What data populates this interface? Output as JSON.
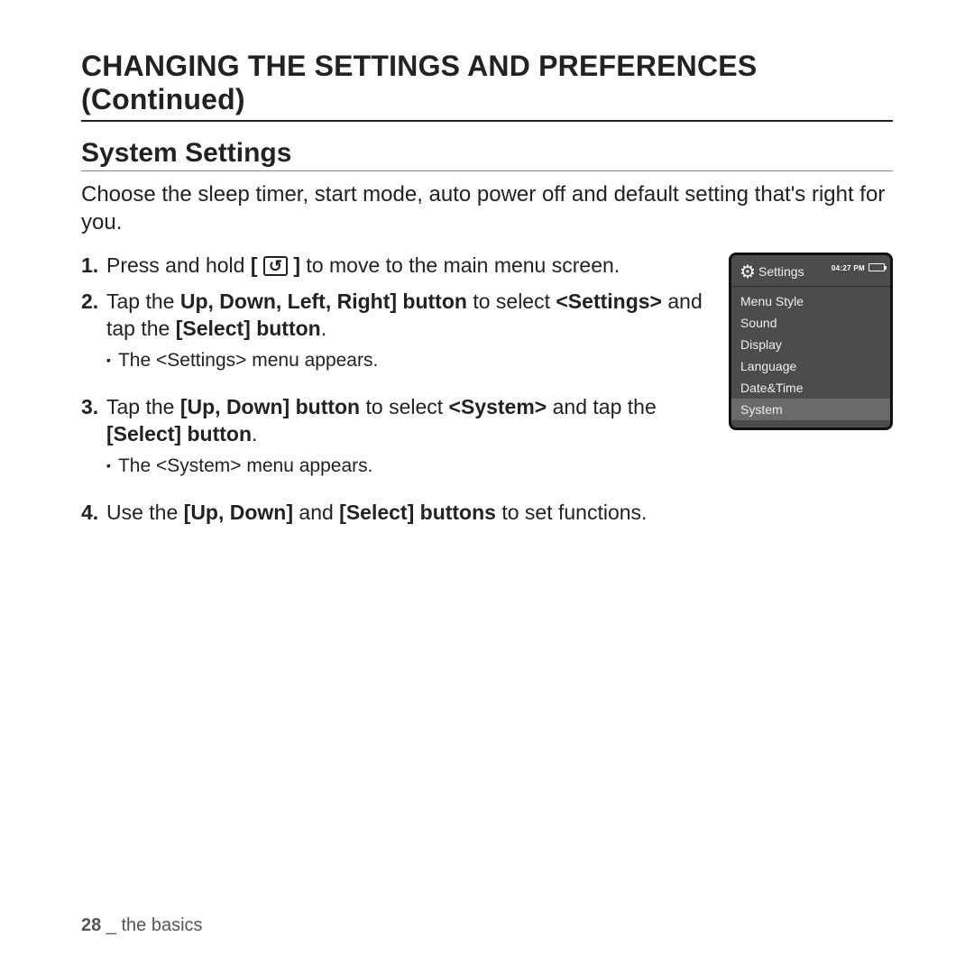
{
  "title": "CHANGING THE SETTINGS AND PREFERENCES (Continued)",
  "section": "System Settings",
  "intro": "Choose the sleep timer, start mode, auto power off and default setting that's right for you.",
  "steps": {
    "s1": {
      "num": "1.",
      "pre": "Press and hold ",
      "key_open": "[ ",
      "key_glyph": "↺",
      "key_close": " ]",
      "post": " to move to the main menu screen."
    },
    "s2": {
      "num": "2.",
      "t1": "Tap the ",
      "b1": "Up, Down, Left, Right] button",
      "t2": " to select ",
      "b2": "<Settings>",
      "t3": " and tap the ",
      "b3": "[Select] button",
      "t4": ".",
      "sub": "The <Settings> menu appears."
    },
    "s3": {
      "num": "3.",
      "t1": "Tap the ",
      "b1": "[Up, Down] button",
      "t2": " to select ",
      "b2": "<System>",
      "t3": " and tap the ",
      "b3": "[Select] button",
      "t4": ".",
      "sub": "The <System> menu appears."
    },
    "s4": {
      "num": "4.",
      "t1": "Use the ",
      "b1": "[Up, Down]",
      "t2": " and ",
      "b2": "[Select] buttons",
      "t3": " to set functions."
    }
  },
  "device": {
    "title": "Settings",
    "time": "04:27 PM",
    "items": [
      "Menu Style",
      "Sound",
      "Display",
      "Language",
      "Date&Time",
      "System"
    ],
    "selected": "System"
  },
  "footer": {
    "page": "28",
    "sep": " _ ",
    "chapter": "the basics"
  }
}
